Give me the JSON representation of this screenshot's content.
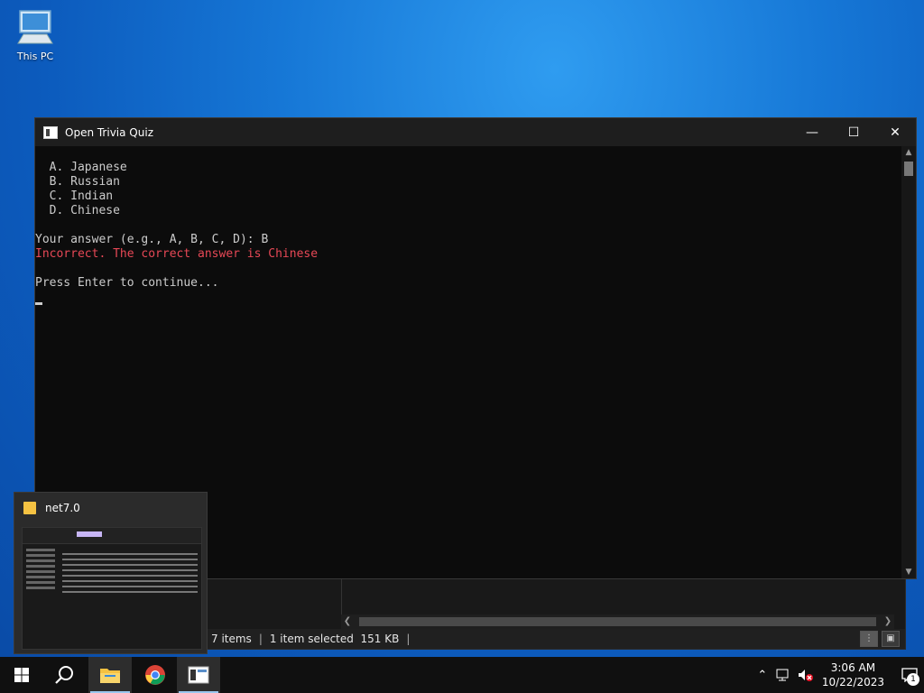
{
  "desktop": {
    "icons": [
      {
        "label": "This PC",
        "icon": "computer-icon"
      }
    ]
  },
  "console": {
    "title": "Open Trivia Quiz",
    "lines": [
      {
        "text": "  A. Japanese",
        "color": "#cccccc"
      },
      {
        "text": "  B. Russian",
        "color": "#cccccc"
      },
      {
        "text": "  C. Indian",
        "color": "#cccccc"
      },
      {
        "text": "  D. Chinese",
        "color": "#cccccc"
      },
      {
        "text": "",
        "color": "#cccccc"
      },
      {
        "text": "Your answer (e.g., A, B, C, D): B",
        "color": "#cccccc"
      },
      {
        "text": "Incorrect. The correct answer is Chinese",
        "color": "#e74856"
      },
      {
        "text": "",
        "color": "#cccccc"
      },
      {
        "text": "Press Enter to continue...",
        "color": "#cccccc"
      }
    ]
  },
  "explorer": {
    "status": {
      "items": "7 items",
      "selected": "1 item selected",
      "size": "151 KB"
    }
  },
  "preview": {
    "title": "net7.0"
  },
  "taskbar": {
    "apps": [
      {
        "name": "start",
        "icon": "windows-logo-icon"
      },
      {
        "name": "search",
        "icon": "search-icon"
      },
      {
        "name": "file-explorer",
        "icon": "folder-icon"
      },
      {
        "name": "chrome",
        "icon": "chrome-icon"
      },
      {
        "name": "console",
        "icon": "console-icon"
      }
    ],
    "clock": {
      "time": "3:06 AM",
      "date": "10/22/2023"
    },
    "notifications": "1"
  }
}
